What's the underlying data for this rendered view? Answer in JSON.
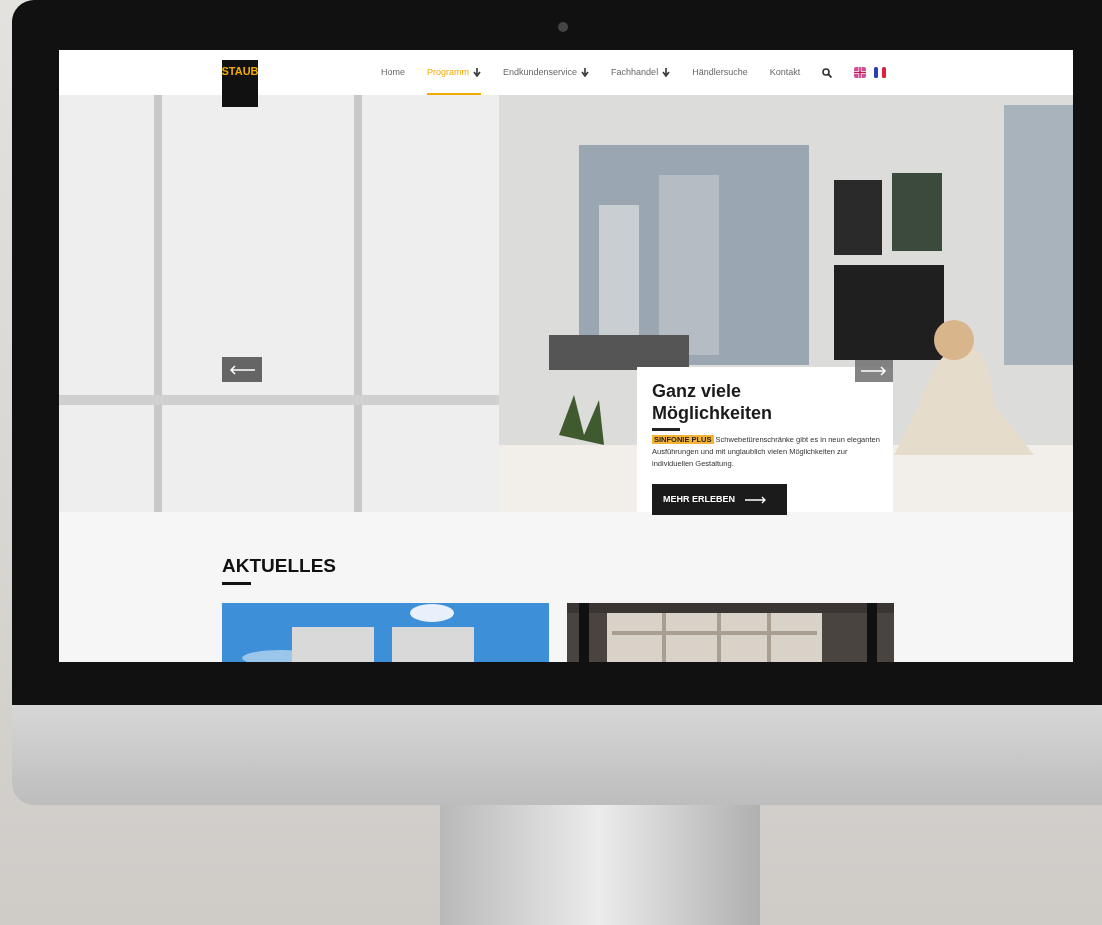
{
  "logo": "STAUB",
  "nav": [
    {
      "label": "Home",
      "selected": false,
      "dropdown": false
    },
    {
      "label": "Programm",
      "selected": true,
      "dropdown": true
    },
    {
      "label": "Endkundenservice",
      "selected": false,
      "dropdown": true
    },
    {
      "label": "Fachhandel",
      "selected": false,
      "dropdown": true
    },
    {
      "label": "Händlersuche",
      "selected": false,
      "dropdown": false
    },
    {
      "label": "Kontakt",
      "selected": false,
      "dropdown": false
    }
  ],
  "hero": {
    "kind": "picture",
    "title": "Ganz viele Möglichkeiten",
    "highlight": "SINFONIE PLUS",
    "text": "Schwebetürenschränke gibt es in neun eleganten Ausführungen und mit unglaublich vielen Möglichkeiten zur individuellen Gestaltung.",
    "button": "MEHR ERLEBEN"
  },
  "news": {
    "heading": "AKTUELLES"
  }
}
